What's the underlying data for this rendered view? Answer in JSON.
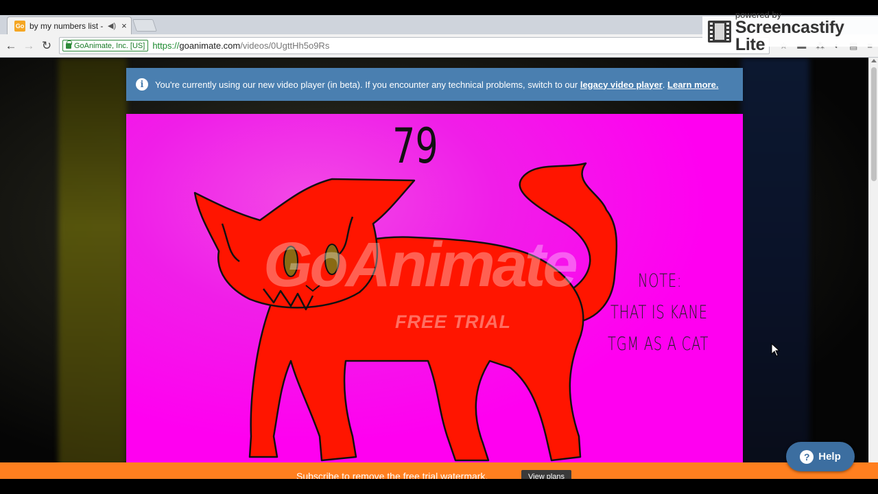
{
  "browser": {
    "tab_title": "by my numbers list - ",
    "tab_favicon_text": "Go",
    "tab_audio_icon": "speaker-icon",
    "tab_close": "×",
    "ev_badge": "GoAnimate, Inc. [US]",
    "url_scheme": "https://",
    "url_host": "goanimate.com",
    "url_path": "/videos/0UgttHh5o9Rs"
  },
  "screencastify": {
    "powered_by": "powered by",
    "brand": "Screencastify Lite"
  },
  "banner": {
    "text": "You're currently using our new video player (in beta). If you encounter any technical problems, switch to our ",
    "legacy_link": "legacy video player",
    "separator": ". ",
    "learn_more": "Learn more."
  },
  "video": {
    "number": "79",
    "note_line1": "NOTE:",
    "note_line2": "THAT IS KANE",
    "note_line3": "TGM AS A CAT",
    "watermark": "GoAnimate",
    "watermark_sub": "FREE TRIAL"
  },
  "footer_bar": {
    "text": "Subscribe to remove the free trial watermark.",
    "button": "View plans"
  },
  "help": {
    "label": "Help",
    "icon": "?"
  },
  "colors": {
    "video_bg": "#ff00f0",
    "cat": "#ff1500",
    "banner": "#4a7fb0",
    "orange_bar": "#ff7f1f",
    "help": "#3c6ea0"
  }
}
